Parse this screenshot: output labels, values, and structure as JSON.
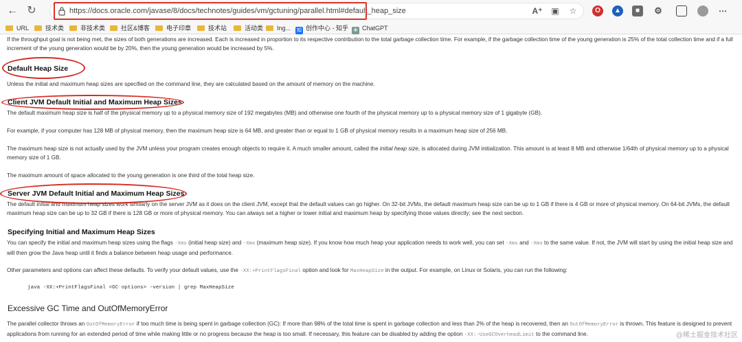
{
  "browser": {
    "url": "https://docs.oracle.com/javase/8/docs/technotes/guides/vm/gctuning/parallel.html#default_heap_size",
    "bookmarks": [
      "URL",
      "技术类",
      "非技术类",
      "社区&博客",
      "电子印章",
      "技术站",
      "活动类",
      "Ing...",
      "创作中心 - 知乎",
      "ChatGPT"
    ]
  },
  "article": {
    "intro": "If the throughput goal is not being met, the sizes of both generations are increased. Each is increased in proportion to its respective contribution to the total garbage collection time. For example, if the garbage collection time of the young generation is 25% of the total collection time and if a full increment of the young generation would be by 20%, then the young generation would be increased by 5%.",
    "default_heading": "Default Heap Size",
    "default_text": "Unless the initial and maximum heap sizes are specified on the command line, they are calculated based on the amount of memory on the machine.",
    "client_heading": "Client JVM Default Initial and Maximum Heap Sizes",
    "client_p1": "The default maximum heap size is half of the physical memory up to a physical memory size of 192 megabytes (MB) and otherwise one fourth of the physical memory up to a physical memory size of 1 gigabyte (GB).",
    "client_p2": "For example, if your computer has 128 MB of physical memory, then the maximum heap size is 64 MB, and greater than or equal to 1 GB of physical memory results in a maximum heap size of 256 MB.",
    "client_p3_a": "The maximum heap size is not actually used by the JVM unless your program creates enough objects to require it. A much smaller amount, called the ",
    "client_p3_em": "initial heap size",
    "client_p3_b": ", is allocated during JVM initialization. This amount is at least 8 MB and otherwise 1/64th of physical memory up to a physical memory size of 1 GB.",
    "client_p4": "The maximum amount of space allocated to the young generation is one third of the total heap size.",
    "server_heading": "Server JVM Default Initial and Maximum Heap Sizes",
    "server_p1": "The default initial and maximum heap sizes work similarly on the server JVM as it does on the client JVM, except that the default values can go higher. On 32-bit JVMs, the default maximum heap size can be up to 1 GB if there is 4 GB or more of physical memory. On 64-bit JVMs, the default maximum heap size can be up to 32 GB if there is 128 GB or more of physical memory. You can always set a higher or lower initial and maximum heap by specifying those values directly; see the next section.",
    "specifying_heading": "Specifying Initial and Maximum Heap Sizes",
    "spec_a": "You can specify the initial and maximum heap sizes using the flags ",
    "spec_xms": "-Xms",
    "spec_b": " (initial heap size) and ",
    "spec_xmx": "-Xmx",
    "spec_c": " (maximum heap size). If you know how much heap your application needs to work well, you can set ",
    "spec_xms2": "-Xms",
    "spec_d": " and ",
    "spec_xmx2": "-Xmx",
    "spec_e": " to the same value. If not, the JVM will start by using the initial heap size and will then grow the Java heap until it finds a balance between heap usage and performance.",
    "other_a": "Other parameters and options can affect these defaults. To verify your default values, use the ",
    "other_flag": "-XX:+PrintFlagsFinal",
    "other_b": " option and look for ",
    "other_name": "MaxHeapSize",
    "other_c": " in the output. For example, on Linux or Solaris, you can run the following:",
    "command": "java -XX:+PrintFlagsFinal <GC options> -version | grep MaxHeapSize",
    "excessive_heading": "Excessive GC Time and OutOfMemoryError",
    "exc_a": "The parallel collector throws an ",
    "exc_oom": "OutOfMemoryError",
    "exc_b": " if too much time is being spent in garbage collection (GC): If more than 98% of the total time is spent in garbage collection and less than 2% of the heap is recovered, then an ",
    "exc_oom2": "OutOfMemoryError",
    "exc_c": " is thrown. This feature is designed to prevent applications from running for an extended period of time while making little or no progress because the heap is too small. If necessary, this feature can be disabled by adding the option ",
    "exc_flag": "-XX:-UseGCOverheadLimit",
    "exc_d": " to the command line."
  },
  "watermark": "@稀土掘金技术社区"
}
